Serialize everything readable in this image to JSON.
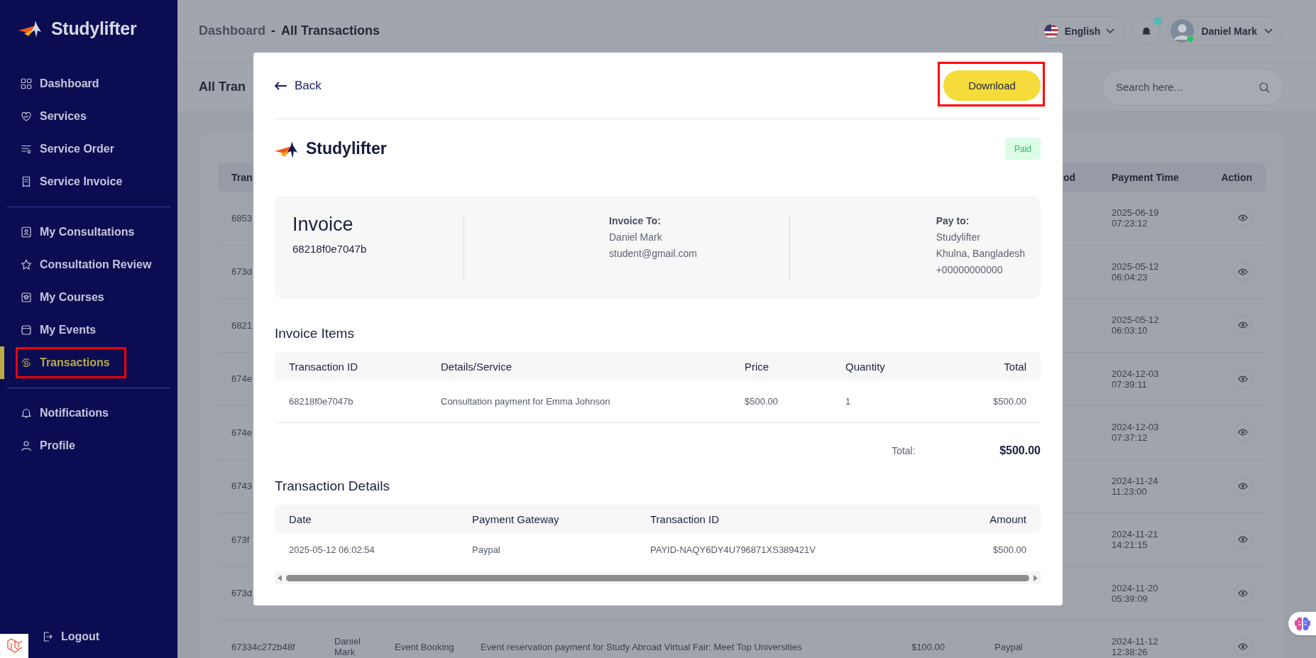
{
  "sidebar": {
    "brand": "Studylifter",
    "sections": [
      {
        "items": [
          {
            "label": "Dashboard",
            "selected": false,
            "highlighted": false
          },
          {
            "label": "Services",
            "selected": false,
            "highlighted": false
          },
          {
            "label": "Service Order",
            "selected": false,
            "highlighted": false
          },
          {
            "label": "Service Invoice",
            "selected": false,
            "highlighted": false
          }
        ]
      },
      {
        "items": [
          {
            "label": "My Consultations",
            "selected": false,
            "highlighted": false
          },
          {
            "label": "Consultation Review",
            "selected": false,
            "highlighted": false
          },
          {
            "label": "My Courses",
            "selected": false,
            "highlighted": false
          },
          {
            "label": "My Events",
            "selected": false,
            "highlighted": false
          },
          {
            "label": "Transactions",
            "selected": true,
            "highlighted": true
          }
        ]
      },
      {
        "items": [
          {
            "label": "Notifications",
            "selected": false,
            "highlighted": false
          },
          {
            "label": "Profile",
            "selected": false,
            "highlighted": false
          }
        ]
      }
    ],
    "logout": "Logout"
  },
  "header": {
    "breadcrumb": [
      "Dashboard",
      "All Transactions"
    ],
    "separator": "-",
    "language": "English",
    "has_notification": true,
    "user": "Daniel Mark",
    "online": true
  },
  "page": {
    "title": "All Tran",
    "search": {
      "placeholder": "Search here..."
    }
  },
  "table": {
    "header": {
      "column_1": "Tran",
      "column_6": "od",
      "column_7": "Payment Time",
      "column_8": "Action"
    },
    "rows": [
      {
        "column_1": "6853",
        "column_7": "2025-06-19 07:23:12"
      },
      {
        "column_1": "673d",
        "column_7": "2025-05-12 06:04:23"
      },
      {
        "column_1": "6821",
        "column_7": "2025-05-12 06:03:10"
      },
      {
        "column_1": "674e",
        "column_7": "2024-12-03 07:39:11"
      },
      {
        "column_1": "674e",
        "column_7": "2024-12-03 07:37:12"
      },
      {
        "column_1": "6743",
        "column_7": "2024-11-24 11:23:00"
      },
      {
        "column_1": "673f",
        "column_7": "2024-11-21 14:21:15"
      },
      {
        "column_1": "673d",
        "column_7": "2024-11-20 05:39:09"
      },
      {
        "column_1": "67334c272b48f",
        "column_2": "Daniel Mark",
        "column_3": "Event Booking",
        "column_4": "Event reservation payment for Study Abroad Virtual Fair: Meet Top Universities",
        "column_5": "$100.00",
        "column_6": "Paypal",
        "column_7": "2024-11-12 12:38:26"
      }
    ]
  },
  "modal": {
    "back": "Back",
    "download": {
      "label": "Download",
      "highlighted": true
    },
    "brand": "Studylifter",
    "status": "Paid",
    "invoice": {
      "title": "Invoice",
      "number": "68218f0e7047b",
      "invoice_to": {
        "heading": "Invoice To:",
        "lines": [
          "Daniel Mark",
          "student@gmail.com"
        ]
      },
      "pay_to": {
        "heading": "Pay to:",
        "lines": [
          "Studylifter",
          "Khulna, Bangladesh",
          "+00000000000"
        ]
      }
    },
    "invoice_items": {
      "title": "Invoice Items",
      "columns": [
        "Transaction ID",
        "Details/Service",
        "Price",
        "Quantity",
        "Total"
      ],
      "rows": [
        [
          "68218f0e7047b",
          "Consultation payment for Emma Johnson",
          "$500.00",
          "1",
          "$500.00"
        ]
      ]
    },
    "total": {
      "label": "Total:",
      "value": "$500.00"
    },
    "transaction_details": {
      "title": "Transaction Details",
      "columns": [
        "Date",
        "Payment Gateway",
        "Transaction ID",
        "Amount"
      ],
      "rows": [
        [
          "2025-05-12 06:02:54",
          "Paypal",
          "PAYID-NAQY6DY4U796871XS389421V",
          "$500.00"
        ]
      ]
    }
  }
}
